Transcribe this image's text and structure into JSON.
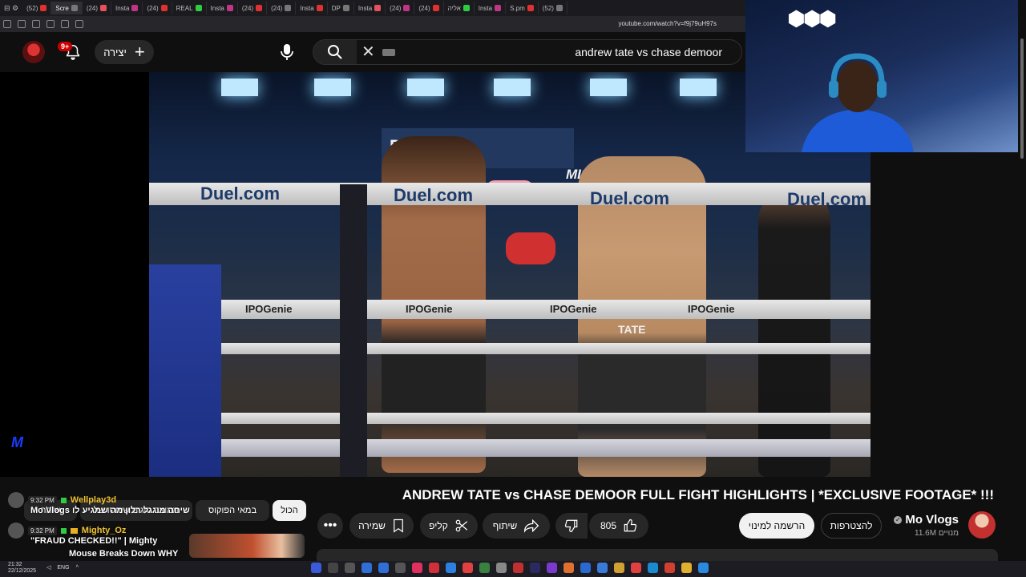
{
  "browser": {
    "tabs": [
      "(52)",
      "Scre",
      "(24)",
      "Insta",
      "(24)",
      "REAL",
      "Insta",
      "(24)",
      "(24)",
      "Insta",
      "DP",
      "Insta",
      "(24)",
      "(24)",
      "אליה",
      "Insta",
      "S.pm",
      "(52)"
    ],
    "url": "youtube.com/watch?v=f9j79uH97s"
  },
  "header": {
    "notification_count": "9+",
    "create_label": "יצירה",
    "search_query": "andrew tate vs chase demoor"
  },
  "video": {
    "title": "ANDREW TATE vs CHASE DEMOOR FULL FIGHT HIGHLIGHTS | *EXCLUSIVE FOOTAGE* !!!",
    "rope_ads": [
      "Duel.com",
      "Duel.com",
      "Duel.com",
      "Duel.com"
    ],
    "sponsor_ads": [
      "IPOGenie",
      "IPOGenie",
      "IPOGenie",
      "IPOGenie"
    ],
    "misfits_text": "MISFITS MANIA",
    "short_name_text": "TATE"
  },
  "channel": {
    "name": "Mo Vlogs",
    "subscribers": "11.6M מנויים",
    "join_label": "להצטרפות",
    "subscribe_label": "הרשמה למינוי"
  },
  "actions": {
    "like_count": "805",
    "share_label": "שיתוף",
    "clip_label": "קליפ",
    "save_label": "שמירה"
  },
  "chips": {
    "all_label": "הכול",
    "chip2": "במאי הפוקוס",
    "chip3": "ממוצב סוגים שיחסו של",
    "chip4": "שיחה"
  },
  "chat": [
    {
      "time": "9:32 PM",
      "user": "Wellplay3d",
      "message": "Mo Vlogs שיחה מוגגל רלון מה שמגיע לו"
    },
    {
      "time": "9:32 PM",
      "user": "Mighty_Oz",
      "message": "\"FRAUD CHECKED!!\" | Mighty"
    }
  ],
  "chat_extra": "Mouse Breaks Down WHY",
  "taskbar": {
    "time": "21:32",
    "date": "22/12/2025",
    "lang": "ENG"
  },
  "colors": {
    "bg": "#0f0f0f",
    "pill": "#272727",
    "accent_red": "#cc0000",
    "chat_user": "#f2c230"
  }
}
